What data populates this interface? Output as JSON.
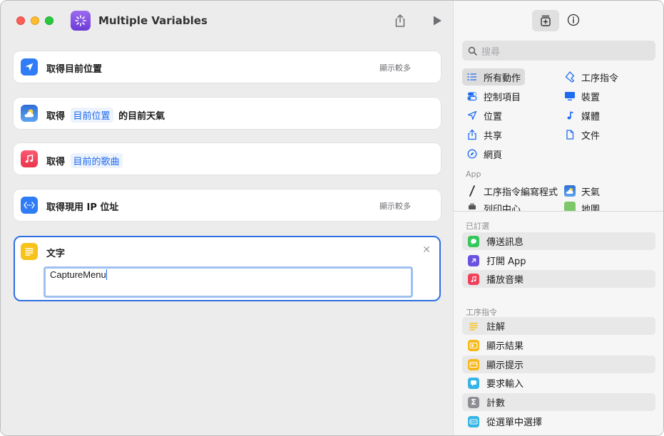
{
  "window": {
    "title": "Multiple Variables"
  },
  "actions": [
    {
      "label": "取得目前位置",
      "more": "顯示較多",
      "icon": "location-arrow-icon",
      "color": "#2f7cf6"
    },
    {
      "prefix": "取得",
      "chip": "目前位置",
      "suffix": "的目前天氣",
      "icon": "weather-icon",
      "color": "#3a88e8"
    },
    {
      "prefix": "取得",
      "chip": "目前的歌曲",
      "icon": "music-note-icon",
      "color": "#f0405a"
    },
    {
      "label": "取得現用 IP 位址",
      "more": "顯示較多",
      "icon": "network-icon",
      "color": "#2f7cf6"
    }
  ],
  "text_action": {
    "label": "文字",
    "value": "CaptureMenu",
    "icon": "text-lines-icon",
    "color": "#f7c21a"
  },
  "sidebar": {
    "search_placeholder": "搜尋",
    "categories": [
      {
        "label": "所有動作",
        "icon": "list-icon",
        "selected": true
      },
      {
        "label": "工序指令",
        "icon": "shortcuts-icon"
      },
      {
        "label": "控制項目",
        "icon": "toggle-icon"
      },
      {
        "label": "裝置",
        "icon": "display-icon"
      },
      {
        "label": "位置",
        "icon": "location-icon"
      },
      {
        "label": "媒體",
        "icon": "music-note-icon"
      },
      {
        "label": "共享",
        "icon": "share-icon"
      },
      {
        "label": "文件",
        "icon": "document-icon"
      },
      {
        "label": "網頁",
        "icon": "compass-icon"
      }
    ],
    "app_section": "App",
    "apps": [
      {
        "label": "工序指令編寫程式",
        "icon": "script-pen-icon"
      },
      {
        "label": "天氣",
        "icon": "weather-icon"
      },
      {
        "label": "列印中心",
        "icon": "printer-icon"
      },
      {
        "label": "地圖",
        "icon": "map-icon"
      }
    ],
    "pinned_section": "已訂選",
    "pinned": [
      {
        "label": "傳送訊息",
        "icon": "message-icon",
        "color": "#34c759"
      },
      {
        "label": "打開 App",
        "icon": "open-app-icon",
        "color": "#6a52e0"
      },
      {
        "label": "播放音樂",
        "icon": "music-icon",
        "color": "#f0405a"
      }
    ],
    "scripting_section": "工序指令",
    "scripting": [
      {
        "label": "註解",
        "icon": "comment-lines-icon",
        "color": "#f7c21a"
      },
      {
        "label": "顯示結果",
        "icon": "show-result-icon",
        "color": "#f7b81a"
      },
      {
        "label": "顯示提示",
        "icon": "alert-icon",
        "color": "#f7b81a"
      },
      {
        "label": "要求輸入",
        "icon": "ask-input-icon",
        "color": "#35b5e6"
      },
      {
        "label": "計數",
        "icon": "sigma-icon",
        "color": "#8e8e93"
      },
      {
        "label": "從選單中選擇",
        "icon": "choose-menu-icon",
        "color": "#35b5e6"
      }
    ]
  }
}
